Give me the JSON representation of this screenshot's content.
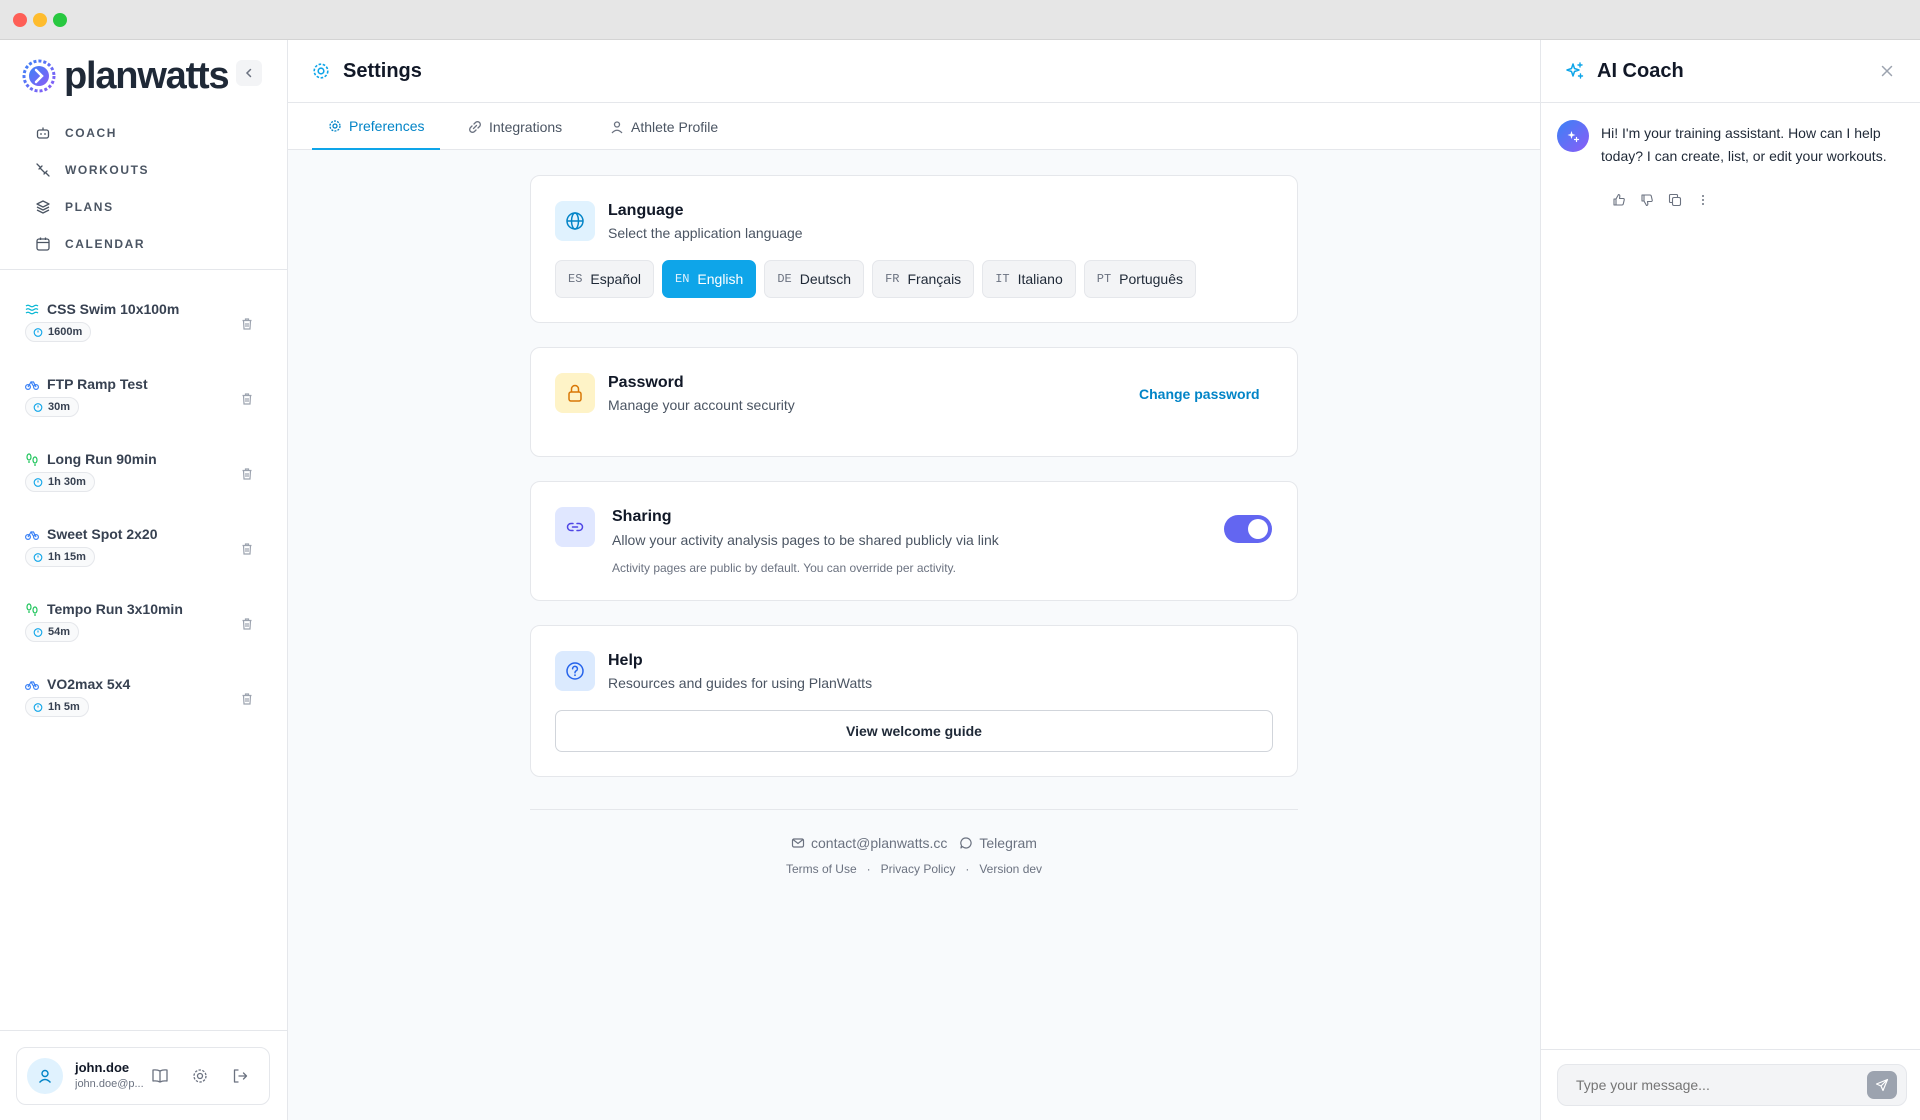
{
  "app": {
    "brand": "planwatts"
  },
  "colors": {
    "accent": "#0ea5e9",
    "toggle": "#6366f1",
    "swim": "#06b6d4",
    "bike": "#3b82f6",
    "run": "#22c55e"
  },
  "sidebar": {
    "nav": [
      {
        "label": "COACH",
        "icon": "robot-icon"
      },
      {
        "label": "WORKOUTS",
        "icon": "workouts-icon"
      },
      {
        "label": "PLANS",
        "icon": "layers-icon"
      },
      {
        "label": "CALENDAR",
        "icon": "calendar-icon"
      }
    ],
    "workouts": [
      {
        "name": "CSS Swim 10x100m",
        "duration": "1600m",
        "sport": "swim"
      },
      {
        "name": "FTP Ramp Test",
        "duration": "30m",
        "sport": "bike"
      },
      {
        "name": "Long Run 90min",
        "duration": "1h 30m",
        "sport": "run"
      },
      {
        "name": "Sweet Spot 2x20",
        "duration": "1h 15m",
        "sport": "bike"
      },
      {
        "name": "Tempo Run 3x10min",
        "duration": "54m",
        "sport": "run"
      },
      {
        "name": "VO2max 5x4",
        "duration": "1h 5m",
        "sport": "bike"
      }
    ],
    "user": {
      "name": "john.doe",
      "email": "john.doe@p..."
    }
  },
  "main": {
    "title": "Settings",
    "tabs": [
      {
        "label": "Preferences",
        "active": true
      },
      {
        "label": "Integrations",
        "active": false
      },
      {
        "label": "Athlete Profile",
        "active": false
      }
    ],
    "language": {
      "title": "Language",
      "subtitle": "Select the application language",
      "options": [
        {
          "code": "ES",
          "label": "Español"
        },
        {
          "code": "EN",
          "label": "English",
          "selected": true
        },
        {
          "code": "DE",
          "label": "Deutsch"
        },
        {
          "code": "FR",
          "label": "Français"
        },
        {
          "code": "IT",
          "label": "Italiano"
        },
        {
          "code": "PT",
          "label": "Português"
        }
      ]
    },
    "password": {
      "title": "Password",
      "subtitle": "Manage your account security",
      "action": "Change password"
    },
    "sharing": {
      "title": "Sharing",
      "subtitle": "Allow your activity analysis pages to be shared publicly via link",
      "note": "Activity pages are public by default. You can override per activity.",
      "enabled": true
    },
    "help": {
      "title": "Help",
      "subtitle": "Resources and guides for using PlanWatts",
      "action": "View welcome guide"
    },
    "footer": {
      "email": "contact@planwatts.cc",
      "telegram": "Telegram",
      "terms": "Terms of Use",
      "privacy": "Privacy Policy",
      "version": "Version dev",
      "separator": "·"
    }
  },
  "ai": {
    "title": "AI Coach",
    "message": "Hi! I'm your training assistant. How can I help today? I can create, list, or edit your workouts.",
    "input_placeholder": "Type your message..."
  }
}
